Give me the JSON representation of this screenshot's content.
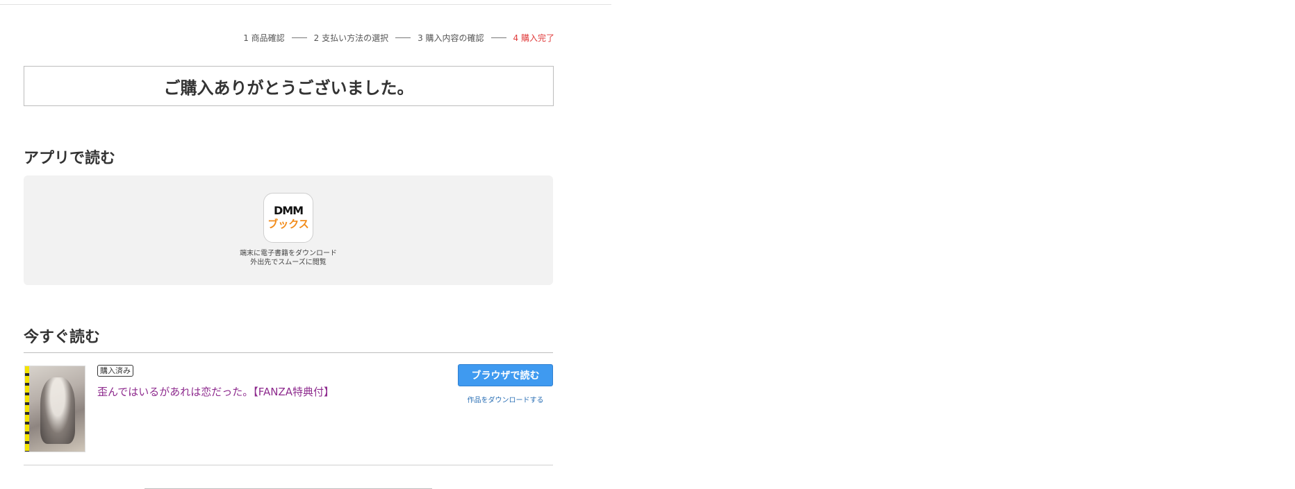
{
  "steps": [
    {
      "label": "1 商品確認"
    },
    {
      "label": "2 支払い方法の選択"
    },
    {
      "label": "3 購入内容の確認"
    },
    {
      "label": "4 購入完了",
      "current": true
    }
  ],
  "thanks": "ご購入ありがとうございました。",
  "app_section": {
    "title": "アプリで読む",
    "app_logo_top": "DMM",
    "app_logo_bottom": "ブックス",
    "caption_line1": "端末に電子書籍をダウンロード",
    "caption_line2": "外出先でスムーズに閲覧"
  },
  "read_now_section": {
    "title": "今すぐ読む",
    "item": {
      "badge": "購入済み",
      "title": "歪んではいるがあれは恋だった。【FANZA特典付】",
      "read_button": "ブラウザで読む",
      "download_link": "作品をダウンロードする"
    }
  },
  "colors": {
    "accent_blue": "#3f9af0",
    "current_step": "#e03a3a",
    "title_link": "#8e2b8e",
    "brand_orange": "#f28c1b"
  }
}
